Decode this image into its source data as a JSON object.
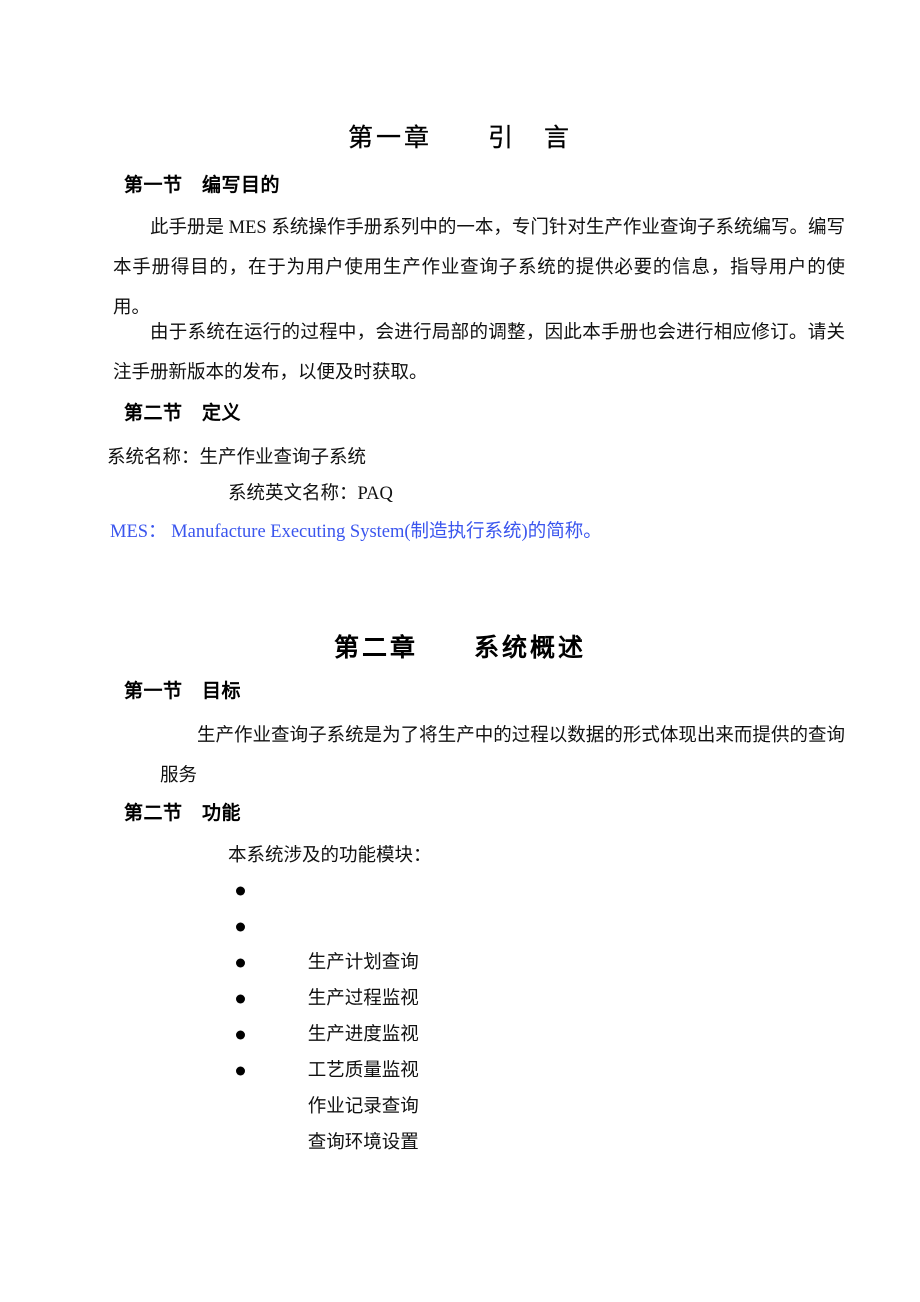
{
  "document": {
    "chapters": [
      {
        "title": "第一章　　引　言",
        "sections": [
          {
            "heading": "第一节　编写目的",
            "paragraphs": [
              "此手册是 MES 系统操作手册系列中的一本，专门针对生产作业查询子系统编写。编写本手册得目的，在于为用户使用生产作业查询子系统的提供必要的信息，指导用户的使用。",
              "由于系统在运行的过程中，会进行局部的调整，因此本手册也会进行相应修订。请关注手册新版本的发布，以便及时获取。"
            ]
          },
          {
            "heading": "第二节　定义",
            "lines": [
              "系统名称：生产作业查询子系统",
              "系统英文名称：PAQ",
              "MES： Manufacture Executing System(制造执行系统)的简称。"
            ]
          }
        ]
      },
      {
        "title": "第二章　　系统概述",
        "sections": [
          {
            "heading": "第一节　目标",
            "paragraphs": [
              "生产作业查询子系统是为了将生产中的过程以数据的形式体现出来而提供的查询服务"
            ]
          },
          {
            "heading": "第二节　功能",
            "intro": "本系统涉及的功能模块：",
            "modules": [
              "生产计划查询",
              "生产过程监视",
              "生产进度监视",
              "工艺质量监视",
              "作业记录查询",
              "查询环境设置"
            ]
          }
        ]
      }
    ],
    "colors": {
      "text": "#111111",
      "accent_blue": "#3A55EE"
    }
  }
}
